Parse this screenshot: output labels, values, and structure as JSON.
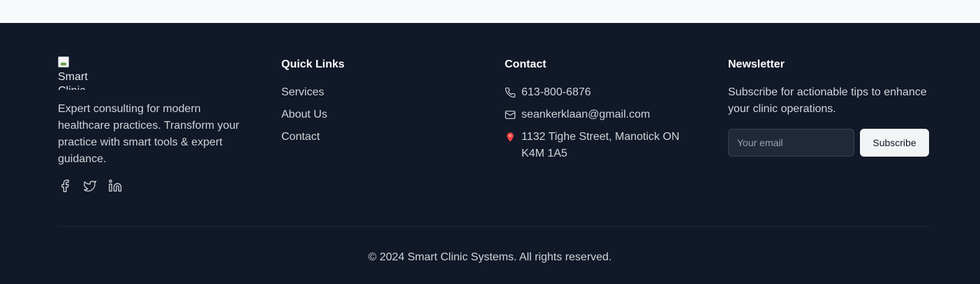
{
  "brand": {
    "logo_alt": "Smart Clinic",
    "description": "Expert consulting for modern healthcare practices. Transform your practice with smart tools & expert guidance.",
    "socials": [
      "facebook-icon",
      "twitter-icon",
      "linkedin-icon"
    ]
  },
  "quick_links": {
    "title": "Quick Links",
    "items": [
      "Services",
      "About Us",
      "Contact"
    ]
  },
  "contact": {
    "title": "Contact",
    "phone": "613-800-6876",
    "email": "seankerklaan@gmail.com",
    "address": "1132 Tighe Street, Manotick ON K4M 1A5"
  },
  "newsletter": {
    "title": "Newsletter",
    "description": "Subscribe for actionable tips to enhance your clinic operations.",
    "email_placeholder": "Your email",
    "email_value": "",
    "button_label": "Subscribe"
  },
  "copyright": "© 2024 Smart Clinic Systems. All rights reserved.",
  "colors": {
    "footer_bg": "#111827",
    "top_strip_bg": "#f8f9fb",
    "heading": "#ffffff",
    "text": "#d1d5db"
  }
}
